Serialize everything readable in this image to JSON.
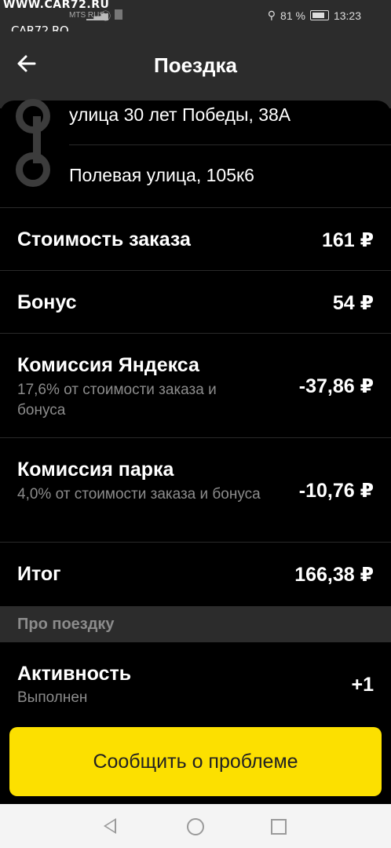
{
  "status_bar": {
    "watermark_top": "WWW.CAR72.RU",
    "watermark_logo": "CAR72.RO",
    "carrier": "MTS RUS",
    "battery": "81 %",
    "time": "13:23"
  },
  "header": {
    "back_icon": "arrow-left-icon",
    "title": "Поездка"
  },
  "route": {
    "from": "улица 30 лет Победы, 38А",
    "to": "Полевая улица, 105к6"
  },
  "breakdown": {
    "order_cost": {
      "label": "Стоимость заказа",
      "value": "161 ₽"
    },
    "bonus": {
      "label": "Бонус",
      "value": "54 ₽"
    },
    "yandex_commission": {
      "label": "Комиссия Яндекса",
      "sub": "17,6% от стоимости заказа и бонуса",
      "value": "-37,86 ₽"
    },
    "park_commission": {
      "label": "Комиссия парка",
      "sub": "4,0% от стоимости заказа и бонуса",
      "value": "-10,76 ₽"
    },
    "total": {
      "label": "Итог",
      "value": "166,38 ₽"
    }
  },
  "about": {
    "section_title": "Про поездку",
    "activity": {
      "label": "Активность",
      "sub": "Выполнен",
      "value": "+1"
    }
  },
  "actions": {
    "report_problem": "Сообщить о проблеме"
  },
  "colors": {
    "accent": "#fce000",
    "background": "#000000",
    "panel": "#2c2c2c",
    "muted_text": "#8c8c8c"
  }
}
